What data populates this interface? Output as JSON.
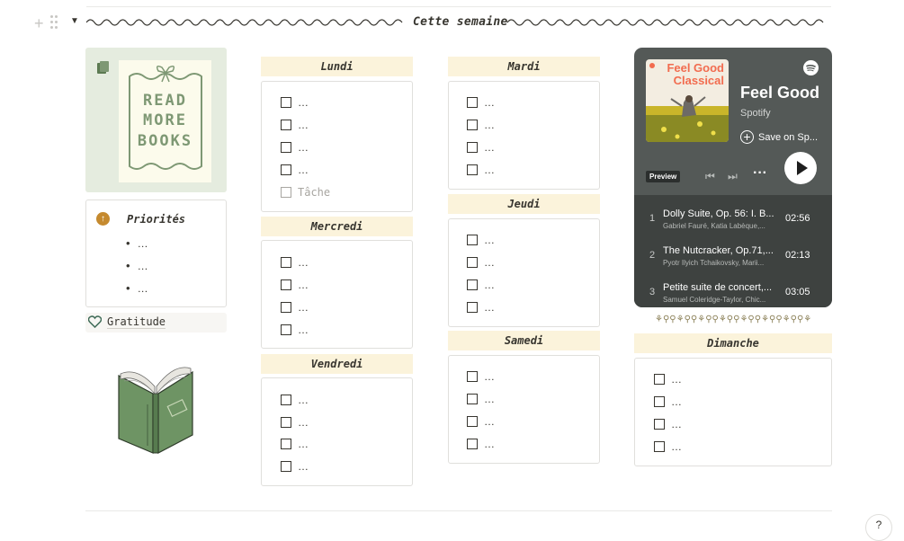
{
  "header": {
    "title": "Cette semaine"
  },
  "left": {
    "poster_lines": [
      "READ",
      "MORE",
      "BOOKS"
    ],
    "priorities": {
      "title": "Priorités",
      "items": [
        "…",
        "…",
        "…"
      ]
    },
    "gratitude_label": "Gratitude"
  },
  "days": {
    "lundi": {
      "title": "Lundi",
      "todos": [
        "…",
        "…",
        "…",
        "…"
      ],
      "placeholder": "Tâche"
    },
    "mercredi": {
      "title": "Mercredi",
      "todos": [
        "…",
        "…",
        "…",
        "…"
      ]
    },
    "vendredi": {
      "title": "Vendredi",
      "todos": [
        "…",
        "…",
        "…",
        "…"
      ]
    },
    "mardi": {
      "title": "Mardi",
      "todos": [
        "…",
        "…",
        "…",
        "…"
      ]
    },
    "jeudi": {
      "title": "Jeudi",
      "todos": [
        "…",
        "…",
        "…",
        "…"
      ]
    },
    "samedi": {
      "title": "Samedi",
      "todos": [
        "…",
        "…",
        "…",
        "…"
      ]
    },
    "dimanche": {
      "title": "Dimanche",
      "todos": [
        "…",
        "…",
        "…",
        "…"
      ]
    }
  },
  "spotify": {
    "cover_title": "Feel Good Classical",
    "playlist_title": "Feel Good",
    "owner": "Spotify",
    "save_label": "Save on Sp...",
    "preview_label": "Preview",
    "tracks": [
      {
        "num": "1",
        "title": "Dolly Suite, Op. 56: I. B...",
        "artist": "Gabriel Fauré, Katia Labèque,...",
        "duration": "02:56"
      },
      {
        "num": "2",
        "title": "The Nutcracker, Op.71,...",
        "artist": "Pyotr Ilyich Tchaikovsky, Marii...",
        "duration": "02:13"
      },
      {
        "num": "3",
        "title": "Petite suite de concert,...",
        "artist": "Samuel Coleridge-Taylor, Chic...",
        "duration": "03:05"
      }
    ]
  },
  "decor": {
    "flowers": "⚘⚲⚲⚘⚲⚲⚘⚲⚲⚘⚲⚲⚘⚲⚲⚘⚲⚲⚘⚲⚲⚘",
    "icons": [
      "plus-icon",
      "drag-handle-icon",
      "toggle-triangle-icon",
      "notebook-icon",
      "arrow-up-circle-icon",
      "heart-icon",
      "spotify-logo-icon",
      "play-icon",
      "help-icon"
    ]
  },
  "colors": {
    "day_header_bg": "#fbf3db",
    "books_tile_bg": "#e5ecdf",
    "spotify_bg": "#545957",
    "priority_icon": "#c58a2f"
  }
}
